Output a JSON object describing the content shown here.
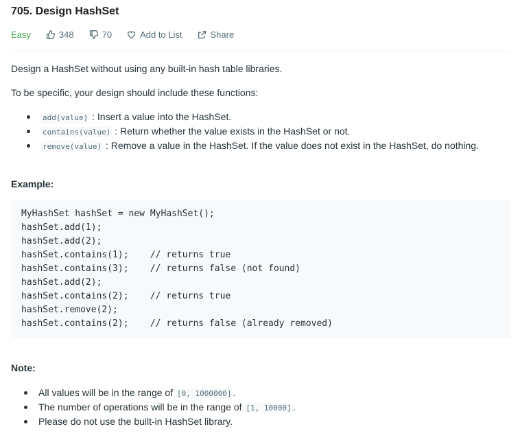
{
  "problem": {
    "title": "705. Design HashSet",
    "difficulty": "Easy",
    "likes": "348",
    "dislikes": "70",
    "add_to_list": "Add to List",
    "share": "Share",
    "difficulty_color": "#43a047"
  },
  "description": {
    "intro": "Design a HashSet without using any built-in hash table libraries.",
    "specific": "To be specific, your design should include these functions:",
    "functions": [
      {
        "code": "add(value)",
        "text": ": Insert a value into the HashSet."
      },
      {
        "code": "contains(value)",
        "text": ": Return whether the value exists in the HashSet or not."
      },
      {
        "code": "remove(value)",
        "text": ": Remove a value in the HashSet. If the value does not exist in the HashSet, do nothing."
      }
    ]
  },
  "example": {
    "heading": "Example:",
    "lines": [
      "MyHashSet hashSet = new MyHashSet();",
      "hashSet.add(1);",
      "hashSet.add(2);",
      "hashSet.contains(1);    // returns true",
      "hashSet.contains(3);    // returns false (not found)",
      "hashSet.add(2);",
      "hashSet.contains(2);    // returns true",
      "hashSet.remove(2);",
      "hashSet.contains(2);    // returns false (already removed)"
    ]
  },
  "note": {
    "heading": "Note:",
    "items": [
      {
        "before": "All values will be in the range of",
        "code": "[0, 1000000]",
        "after": "."
      },
      {
        "before": "The number of operations will be in the range of",
        "code": "[1, 10000]",
        "after": "."
      },
      {
        "before": "Please do not use the built-in HashSet library.",
        "code": "",
        "after": ""
      }
    ]
  },
  "icons": {
    "like": "thumbs-up-icon",
    "dislike": "thumbs-down-icon",
    "add_to_list": "heart-icon",
    "share": "share-icon"
  }
}
